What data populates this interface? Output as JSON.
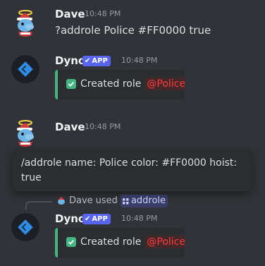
{
  "messages": [
    {
      "author": "Dave",
      "time": "10:48 PM",
      "text": "?addrole Police #FF0000 true"
    },
    {
      "author": "Dyno",
      "badge": "APP",
      "time": "10:48 PM",
      "embed": {
        "prefix": "Created role",
        "role": "@Police"
      }
    },
    {
      "author": "Dave",
      "time": "10:48 PM"
    },
    {
      "author": "Dyno",
      "badge": "APP",
      "time": "10:48 PM",
      "embed": {
        "prefix": "Created role",
        "role": "@Police"
      }
    }
  ],
  "tooltip": {
    "text": "/addrole name: Police color: #FF0000 hoist: true"
  },
  "command_use": {
    "user": "Dave",
    "action": "used",
    "command": "addrole"
  },
  "colors": {
    "background": "#313338",
    "embed_background": "#2b2d31",
    "embed_accent": "#43b581",
    "app_badge": "#5865f2",
    "role_color": "#FF0000",
    "dyno_avatar": "#1c1f24",
    "dyno_logo": "#2d8ce5"
  }
}
